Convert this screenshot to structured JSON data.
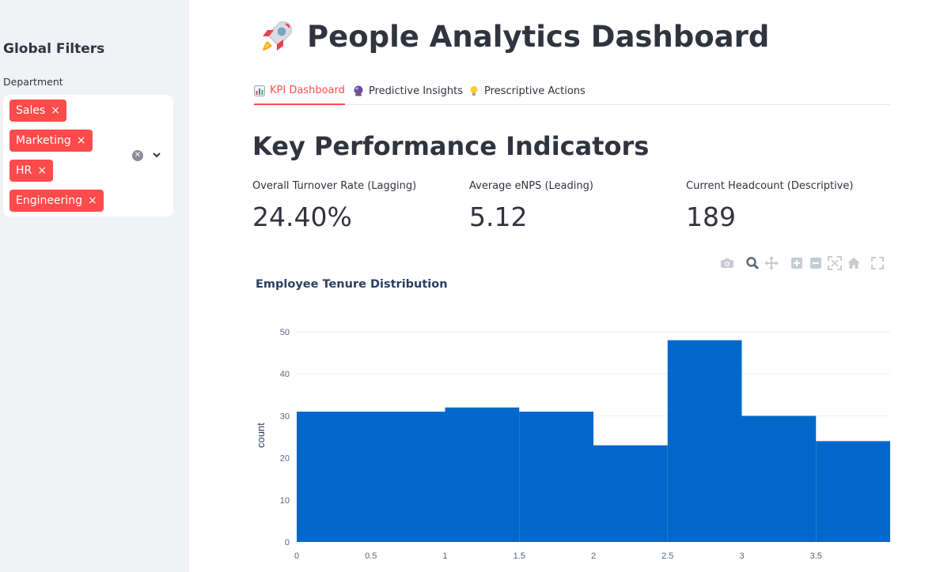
{
  "sidebar": {
    "title": "Global Filters",
    "filter_label": "Department",
    "selected": [
      "Sales",
      "Marketing",
      "HR",
      "Engineering"
    ]
  },
  "page": {
    "title": "People Analytics Dashboard",
    "icon": "rocket-icon"
  },
  "tabs": [
    {
      "label": "KPI Dashboard",
      "icon": "bar-chart-icon",
      "active": true
    },
    {
      "label": "Predictive Insights",
      "icon": "crystal-ball-icon",
      "active": false
    },
    {
      "label": "Prescriptive Actions",
      "icon": "lightbulb-icon",
      "active": false
    }
  ],
  "section": {
    "heading": "Key Performance Indicators"
  },
  "metrics": [
    {
      "label": "Overall Turnover Rate (Lagging)",
      "value": "24.40%"
    },
    {
      "label": "Average eNPS (Leading)",
      "value": "5.12"
    },
    {
      "label": "Current Headcount (Descriptive)",
      "value": "189"
    }
  ],
  "toolbar": [
    "camera-icon",
    "zoom-icon",
    "pan-icon",
    "zoom-in-icon",
    "zoom-out-icon",
    "autoscale-icon",
    "reset-axes-icon",
    "fullscreen-icon"
  ],
  "colors": {
    "accent": "#ff4b4b",
    "bar": "#0068c9",
    "sidebar_bg": "#f0f2f6"
  },
  "chart_data": {
    "type": "bar",
    "title": "Employee Tenure Distribution",
    "ylabel": "count",
    "xlabel": "",
    "bins": [
      [
        0,
        1,
        31
      ],
      [
        1,
        1.5,
        32
      ],
      [
        1.5,
        2,
        31
      ],
      [
        2,
        2.5,
        23
      ],
      [
        2.5,
        3,
        48
      ],
      [
        3,
        3.5,
        30
      ],
      [
        3.5,
        4,
        24
      ]
    ],
    "xticks": [
      "0",
      "0.5",
      "1",
      "1.5",
      "2",
      "2.5",
      "3",
      "3.5"
    ],
    "yticks": [
      "0",
      "10",
      "20",
      "30",
      "40",
      "50"
    ],
    "xlim": [
      0,
      4
    ],
    "ylim": [
      0,
      50
    ],
    "grid": true
  }
}
